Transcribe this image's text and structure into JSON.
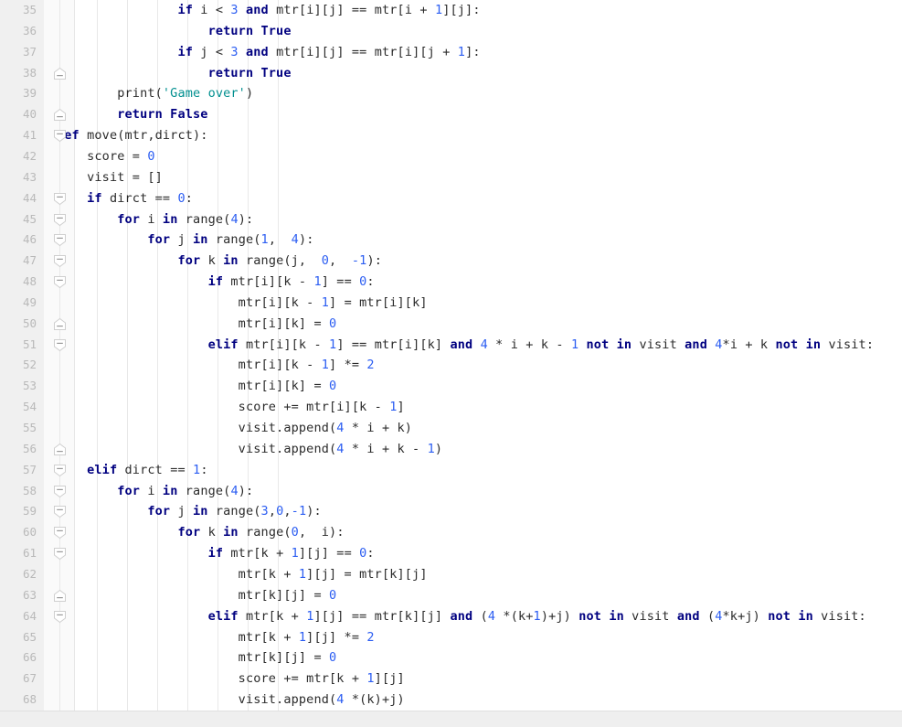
{
  "editor": {
    "language": "Python",
    "colors": {
      "background": "#ffffff",
      "gutter_background": "#f0f0f0",
      "fold_strip_background": "#fafafa",
      "line_number": "#b9b9b9",
      "keyword": "#000080",
      "number": "#2b5df2",
      "string": "#008f8f",
      "identifier": "#2b2b2b",
      "indent_guide": "#e8e8e8",
      "footer": "#efefef"
    },
    "first_line": 35,
    "last_line": 68,
    "indent_guide_positions": [
      65,
      106,
      139,
      172,
      205,
      238,
      271,
      304
    ],
    "lines": [
      {
        "n": 35,
        "fold": null,
        "text": "                if i < 3 and mtr[i][j] == mtr[i + 1][j]:",
        "tokens": [
          {
            "t": "                ",
            "c": "id"
          },
          {
            "t": "if",
            "c": "kw"
          },
          {
            "t": " i ",
            "c": "id"
          },
          {
            "t": "<",
            "c": "op"
          },
          {
            "t": " ",
            "c": "id"
          },
          {
            "t": "3",
            "c": "num"
          },
          {
            "t": " ",
            "c": "id"
          },
          {
            "t": "and",
            "c": "kw"
          },
          {
            "t": " mtr[i][j] == mtr[i + ",
            "c": "id"
          },
          {
            "t": "1",
            "c": "num"
          },
          {
            "t": "][j]:",
            "c": "id"
          }
        ]
      },
      {
        "n": 36,
        "fold": null,
        "text": "                    return True",
        "tokens": [
          {
            "t": "                    ",
            "c": "id"
          },
          {
            "t": "return True",
            "c": "kw"
          }
        ]
      },
      {
        "n": 37,
        "fold": null,
        "text": "                if j < 3 and mtr[i][j] == mtr[i][j + 1]:",
        "tokens": [
          {
            "t": "                ",
            "c": "id"
          },
          {
            "t": "if",
            "c": "kw"
          },
          {
            "t": " j ",
            "c": "id"
          },
          {
            "t": "<",
            "c": "op"
          },
          {
            "t": " ",
            "c": "id"
          },
          {
            "t": "3",
            "c": "num"
          },
          {
            "t": " ",
            "c": "id"
          },
          {
            "t": "and",
            "c": "kw"
          },
          {
            "t": " mtr[i][j] == mtr[i][j + ",
            "c": "id"
          },
          {
            "t": "1",
            "c": "num"
          },
          {
            "t": "]:",
            "c": "id"
          }
        ]
      },
      {
        "n": 38,
        "fold": "collapse-end",
        "text": "                    return True",
        "tokens": [
          {
            "t": "                    ",
            "c": "id"
          },
          {
            "t": "return True",
            "c": "kw"
          }
        ]
      },
      {
        "n": 39,
        "fold": null,
        "text": "        print('Game over')",
        "tokens": [
          {
            "t": "        ",
            "c": "id"
          },
          {
            "t": "print",
            "c": "fn"
          },
          {
            "t": "(",
            "c": "op"
          },
          {
            "t": "'Game over'",
            "c": "str"
          },
          {
            "t": ")",
            "c": "op"
          }
        ]
      },
      {
        "n": 40,
        "fold": "collapse-end",
        "text": "        return False",
        "tokens": [
          {
            "t": "        ",
            "c": "id"
          },
          {
            "t": "return False",
            "c": "kw"
          }
        ]
      },
      {
        "n": 41,
        "fold": "collapse",
        "text": "def move(mtr,dirct):",
        "tokens": [
          {
            "t": "def",
            "c": "kw"
          },
          {
            "t": " move(mtr,dirct):",
            "c": "id"
          }
        ]
      },
      {
        "n": 42,
        "fold": null,
        "text": "    score = 0",
        "tokens": [
          {
            "t": "    score = ",
            "c": "id"
          },
          {
            "t": "0",
            "c": "num"
          }
        ]
      },
      {
        "n": 43,
        "fold": null,
        "text": "    visit = []",
        "tokens": [
          {
            "t": "    visit = []",
            "c": "id"
          }
        ]
      },
      {
        "n": 44,
        "fold": "collapse",
        "text": "    if dirct == 0:",
        "tokens": [
          {
            "t": "    ",
            "c": "id"
          },
          {
            "t": "if",
            "c": "kw"
          },
          {
            "t": " dirct == ",
            "c": "id"
          },
          {
            "t": "0",
            "c": "num"
          },
          {
            "t": ":",
            "c": "id"
          }
        ]
      },
      {
        "n": 45,
        "fold": "collapse",
        "text": "        for i in range(4):",
        "tokens": [
          {
            "t": "        ",
            "c": "id"
          },
          {
            "t": "for",
            "c": "kw"
          },
          {
            "t": " i ",
            "c": "id"
          },
          {
            "t": "in",
            "c": "kw"
          },
          {
            "t": " range(",
            "c": "id"
          },
          {
            "t": "4",
            "c": "num"
          },
          {
            "t": "):",
            "c": "id"
          }
        ]
      },
      {
        "n": 46,
        "fold": "collapse",
        "text": "            for j in range(1,  4):",
        "tokens": [
          {
            "t": "            ",
            "c": "id"
          },
          {
            "t": "for",
            "c": "kw"
          },
          {
            "t": " j ",
            "c": "id"
          },
          {
            "t": "in",
            "c": "kw"
          },
          {
            "t": " range(",
            "c": "id"
          },
          {
            "t": "1",
            "c": "num"
          },
          {
            "t": ",  ",
            "c": "id"
          },
          {
            "t": "4",
            "c": "num"
          },
          {
            "t": "):",
            "c": "id"
          }
        ]
      },
      {
        "n": 47,
        "fold": "collapse",
        "text": "                for k in range(j,  0,  -1):",
        "tokens": [
          {
            "t": "                ",
            "c": "id"
          },
          {
            "t": "for",
            "c": "kw"
          },
          {
            "t": " k ",
            "c": "id"
          },
          {
            "t": "in",
            "c": "kw"
          },
          {
            "t": " range(j,  ",
            "c": "id"
          },
          {
            "t": "0",
            "c": "num"
          },
          {
            "t": ",  ",
            "c": "id"
          },
          {
            "t": "-1",
            "c": "num"
          },
          {
            "t": "):",
            "c": "id"
          }
        ]
      },
      {
        "n": 48,
        "fold": "collapse",
        "text": "                    if mtr[i][k - 1] == 0:",
        "tokens": [
          {
            "t": "                    ",
            "c": "id"
          },
          {
            "t": "if",
            "c": "kw"
          },
          {
            "t": " mtr[i][k - ",
            "c": "id"
          },
          {
            "t": "1",
            "c": "num"
          },
          {
            "t": "] == ",
            "c": "id"
          },
          {
            "t": "0",
            "c": "num"
          },
          {
            "t": ":",
            "c": "id"
          }
        ]
      },
      {
        "n": 49,
        "fold": null,
        "text": "                        mtr[i][k - 1] = mtr[i][k]",
        "tokens": [
          {
            "t": "                        mtr[i][k - ",
            "c": "id"
          },
          {
            "t": "1",
            "c": "num"
          },
          {
            "t": "] = mtr[i][k]",
            "c": "id"
          }
        ]
      },
      {
        "n": 50,
        "fold": "collapse-end",
        "text": "                        mtr[i][k] = 0",
        "tokens": [
          {
            "t": "                        mtr[i][k] = ",
            "c": "id"
          },
          {
            "t": "0",
            "c": "num"
          }
        ]
      },
      {
        "n": 51,
        "fold": "collapse",
        "text": "                    elif mtr[i][k - 1] == mtr[i][k] and 4 * i + k - 1 not in visit and 4*i + k not in visit:",
        "tokens": [
          {
            "t": "                    ",
            "c": "id"
          },
          {
            "t": "elif",
            "c": "kw"
          },
          {
            "t": " mtr[i][k - ",
            "c": "id"
          },
          {
            "t": "1",
            "c": "num"
          },
          {
            "t": "] == mtr[i][k] ",
            "c": "id"
          },
          {
            "t": "and",
            "c": "kw"
          },
          {
            "t": " ",
            "c": "id"
          },
          {
            "t": "4",
            "c": "num"
          },
          {
            "t": " * i + k - ",
            "c": "id"
          },
          {
            "t": "1",
            "c": "num"
          },
          {
            "t": " ",
            "c": "id"
          },
          {
            "t": "not in",
            "c": "kw"
          },
          {
            "t": " visit ",
            "c": "id"
          },
          {
            "t": "and",
            "c": "kw"
          },
          {
            "t": " ",
            "c": "id"
          },
          {
            "t": "4",
            "c": "num"
          },
          {
            "t": "*i + k ",
            "c": "id"
          },
          {
            "t": "not in",
            "c": "kw"
          },
          {
            "t": " visit:",
            "c": "id"
          }
        ]
      },
      {
        "n": 52,
        "fold": null,
        "text": "                        mtr[i][k - 1] *= 2",
        "tokens": [
          {
            "t": "                        mtr[i][k - ",
            "c": "id"
          },
          {
            "t": "1",
            "c": "num"
          },
          {
            "t": "] *= ",
            "c": "id"
          },
          {
            "t": "2",
            "c": "num"
          }
        ]
      },
      {
        "n": 53,
        "fold": null,
        "text": "                        mtr[i][k] = 0",
        "tokens": [
          {
            "t": "                        mtr[i][k] = ",
            "c": "id"
          },
          {
            "t": "0",
            "c": "num"
          }
        ]
      },
      {
        "n": 54,
        "fold": null,
        "text": "                        score += mtr[i][k - 1]",
        "tokens": [
          {
            "t": "                        score += mtr[i][k - ",
            "c": "id"
          },
          {
            "t": "1",
            "c": "num"
          },
          {
            "t": "]",
            "c": "id"
          }
        ]
      },
      {
        "n": 55,
        "fold": null,
        "text": "                        visit.append(4 * i + k)",
        "tokens": [
          {
            "t": "                        visit.append(",
            "c": "id"
          },
          {
            "t": "4",
            "c": "num"
          },
          {
            "t": " * i + k)",
            "c": "id"
          }
        ]
      },
      {
        "n": 56,
        "fold": "collapse-end",
        "text": "                        visit.append(4 * i + k - 1)",
        "tokens": [
          {
            "t": "                        visit.append(",
            "c": "id"
          },
          {
            "t": "4",
            "c": "num"
          },
          {
            "t": " * i + k - ",
            "c": "id"
          },
          {
            "t": "1",
            "c": "num"
          },
          {
            "t": ")",
            "c": "id"
          }
        ]
      },
      {
        "n": 57,
        "fold": "collapse",
        "text": "    elif dirct == 1:",
        "tokens": [
          {
            "t": "    ",
            "c": "id"
          },
          {
            "t": "elif",
            "c": "kw"
          },
          {
            "t": " dirct == ",
            "c": "id"
          },
          {
            "t": "1",
            "c": "num"
          },
          {
            "t": ":",
            "c": "id"
          }
        ]
      },
      {
        "n": 58,
        "fold": "collapse",
        "text": "        for i in range(4):",
        "tokens": [
          {
            "t": "        ",
            "c": "id"
          },
          {
            "t": "for",
            "c": "kw"
          },
          {
            "t": " i ",
            "c": "id"
          },
          {
            "t": "in",
            "c": "kw"
          },
          {
            "t": " range(",
            "c": "id"
          },
          {
            "t": "4",
            "c": "num"
          },
          {
            "t": "):",
            "c": "id"
          }
        ]
      },
      {
        "n": 59,
        "fold": "collapse",
        "text": "            for j in range(3,0,-1):",
        "tokens": [
          {
            "t": "            ",
            "c": "id"
          },
          {
            "t": "for",
            "c": "kw"
          },
          {
            "t": " j ",
            "c": "id"
          },
          {
            "t": "in",
            "c": "kw"
          },
          {
            "t": " range(",
            "c": "id"
          },
          {
            "t": "3",
            "c": "num"
          },
          {
            "t": ",",
            "c": "id"
          },
          {
            "t": "0",
            "c": "num"
          },
          {
            "t": ",",
            "c": "id"
          },
          {
            "t": "-1",
            "c": "num"
          },
          {
            "t": "):",
            "c": "id"
          }
        ]
      },
      {
        "n": 60,
        "fold": "collapse",
        "text": "                for k in range(0,  i):",
        "tokens": [
          {
            "t": "                ",
            "c": "id"
          },
          {
            "t": "for",
            "c": "kw"
          },
          {
            "t": " k ",
            "c": "id"
          },
          {
            "t": "in",
            "c": "kw"
          },
          {
            "t": " range(",
            "c": "id"
          },
          {
            "t": "0",
            "c": "num"
          },
          {
            "t": ",  i):",
            "c": "id"
          }
        ]
      },
      {
        "n": 61,
        "fold": "collapse",
        "text": "                    if mtr[k + 1][j] == 0:",
        "tokens": [
          {
            "t": "                    ",
            "c": "id"
          },
          {
            "t": "if",
            "c": "kw"
          },
          {
            "t": " mtr[k + ",
            "c": "id"
          },
          {
            "t": "1",
            "c": "num"
          },
          {
            "t": "][j] == ",
            "c": "id"
          },
          {
            "t": "0",
            "c": "num"
          },
          {
            "t": ":",
            "c": "id"
          }
        ]
      },
      {
        "n": 62,
        "fold": null,
        "text": "                        mtr[k + 1][j] = mtr[k][j]",
        "tokens": [
          {
            "t": "                        mtr[k + ",
            "c": "id"
          },
          {
            "t": "1",
            "c": "num"
          },
          {
            "t": "][j] = mtr[k][j]",
            "c": "id"
          }
        ]
      },
      {
        "n": 63,
        "fold": "collapse-end",
        "text": "                        mtr[k][j] = 0",
        "tokens": [
          {
            "t": "                        mtr[k][j] = ",
            "c": "id"
          },
          {
            "t": "0",
            "c": "num"
          }
        ]
      },
      {
        "n": 64,
        "fold": "collapse",
        "text": "                    elif mtr[k + 1][j] == mtr[k][j] and (4 *(k+1)+j) not in visit and (4*k+j) not in visit:",
        "tokens": [
          {
            "t": "                    ",
            "c": "id"
          },
          {
            "t": "elif",
            "c": "kw"
          },
          {
            "t": " mtr[k + ",
            "c": "id"
          },
          {
            "t": "1",
            "c": "num"
          },
          {
            "t": "][j] == mtr[k][j] ",
            "c": "id"
          },
          {
            "t": "and",
            "c": "kw"
          },
          {
            "t": " (",
            "c": "id"
          },
          {
            "t": "4",
            "c": "num"
          },
          {
            "t": " *(k+",
            "c": "id"
          },
          {
            "t": "1",
            "c": "num"
          },
          {
            "t": ")+j) ",
            "c": "id"
          },
          {
            "t": "not in",
            "c": "kw"
          },
          {
            "t": " visit ",
            "c": "id"
          },
          {
            "t": "and",
            "c": "kw"
          },
          {
            "t": " (",
            "c": "id"
          },
          {
            "t": "4",
            "c": "num"
          },
          {
            "t": "*k+j) ",
            "c": "id"
          },
          {
            "t": "not in",
            "c": "kw"
          },
          {
            "t": " visit:",
            "c": "id"
          }
        ]
      },
      {
        "n": 65,
        "fold": null,
        "text": "                        mtr[k + 1][j] *= 2",
        "tokens": [
          {
            "t": "                        mtr[k + ",
            "c": "id"
          },
          {
            "t": "1",
            "c": "num"
          },
          {
            "t": "][j] *= ",
            "c": "id"
          },
          {
            "t": "2",
            "c": "num"
          }
        ]
      },
      {
        "n": 66,
        "fold": null,
        "text": "                        mtr[k][j] = 0",
        "tokens": [
          {
            "t": "                        mtr[k][j] = ",
            "c": "id"
          },
          {
            "t": "0",
            "c": "num"
          }
        ]
      },
      {
        "n": 67,
        "fold": null,
        "text": "                        score += mtr[k + 1][j]",
        "tokens": [
          {
            "t": "                        score += mtr[k + ",
            "c": "id"
          },
          {
            "t": "1",
            "c": "num"
          },
          {
            "t": "][j]",
            "c": "id"
          }
        ]
      },
      {
        "n": 68,
        "fold": null,
        "text": "                        visit.append(4 *(k)+j)",
        "tokens": [
          {
            "t": "                        visit.append(",
            "c": "id"
          },
          {
            "t": "4",
            "c": "num"
          },
          {
            "t": " *(k)+j)",
            "c": "id"
          }
        ]
      }
    ]
  }
}
